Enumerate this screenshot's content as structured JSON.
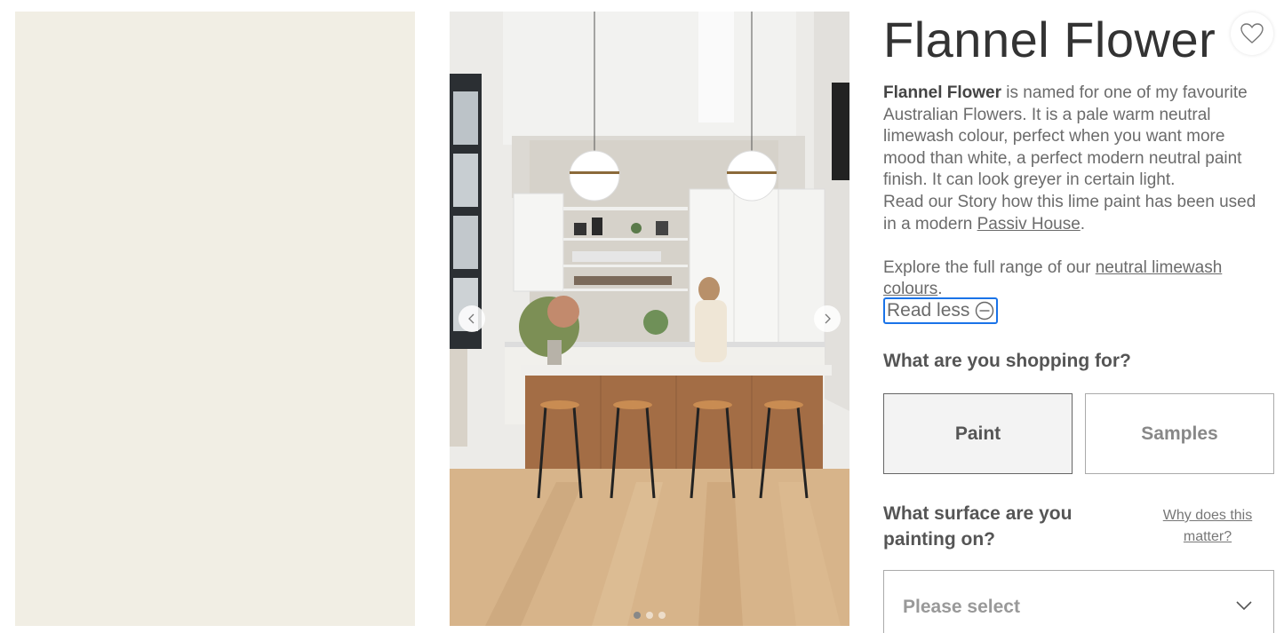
{
  "product": {
    "title": "Flannel Flower",
    "swatch_color": "#f1eee4"
  },
  "gallery": {
    "prev_icon": "chevron-left-icon",
    "next_icon": "chevron-right-icon",
    "slide_count": 3,
    "active_slide": 1
  },
  "favourite": {
    "icon": "heart-outline-icon"
  },
  "description": {
    "name_bold": "Flannel Flower",
    "intro": " is named for one of my favourite Australian Flowers. It is a pale warm neutral limewash colour, perfect when you want more mood than white, a perfect modern neutral paint finish. It can look greyer in certain light.",
    "story_prefix": "Read our Story how this lime paint has been used in a modern ",
    "story_link": "Passiv House",
    "story_suffix": ".",
    "explore_prefix": "Explore the full range of our ",
    "explore_link": "neutral limewash colours",
    "explore_suffix": "."
  },
  "read_less": {
    "label": "Read less",
    "icon": "minus-circle-icon"
  },
  "shopping": {
    "question": "What are you shopping for?",
    "options": [
      "Paint",
      "Samples"
    ],
    "selected": "Paint"
  },
  "surface": {
    "question": "What surface are you painting on?",
    "help_link": "Why does this matter?",
    "select_placeholder": "Please select",
    "select_icon": "chevron-down-icon"
  }
}
